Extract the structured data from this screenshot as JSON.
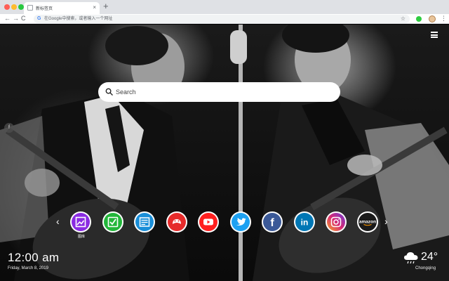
{
  "browser": {
    "tab_title": "新标签页",
    "tab_close": "×",
    "new_tab": "+",
    "omnibox_placeholder": "在Google中搜索，或者输入一个网址",
    "nav": {
      "back": "←",
      "forward": "→",
      "reload": "C"
    }
  },
  "page": {
    "search": {
      "placeholder": "Search"
    },
    "side_toggle_icon": "f",
    "shortcuts": [
      {
        "name": "gallery",
        "label": "图库",
        "color": "#8a2be2",
        "icon": "image-icon"
      },
      {
        "name": "tasks",
        "label": "",
        "color": "#22b63a",
        "icon": "check-icon"
      },
      {
        "name": "news",
        "label": "",
        "color": "#1a8fd9",
        "icon": "news-icon"
      },
      {
        "name": "games",
        "label": "",
        "color": "#e62b2b",
        "icon": "gamepad-icon"
      },
      {
        "name": "youtube",
        "label": "",
        "color": "#ff1f1f",
        "icon": "youtube-icon"
      },
      {
        "name": "twitter",
        "label": "",
        "color": "#1da1f2",
        "icon": "twitter-icon"
      },
      {
        "name": "facebook",
        "label": "",
        "color": "#3b5998",
        "icon": "facebook-icon"
      },
      {
        "name": "linkedin",
        "label": "",
        "color": "#0077b5",
        "icon": "linkedin-icon"
      },
      {
        "name": "instagram",
        "label": "",
        "color": "#d62976",
        "icon": "instagram-icon"
      },
      {
        "name": "amazon",
        "label": "",
        "color": "#1a1a1a",
        "icon": "amazon-icon"
      }
    ],
    "shortcut_text": {
      "facebook": "f",
      "linkedin": "in",
      "amazon": "amazon"
    },
    "clock": {
      "time": "12:00 am",
      "date": "Friday, March 8, 2019"
    },
    "weather": {
      "temperature": "24°",
      "city": "Chongqing",
      "icon": "cloud-rain-icon"
    }
  }
}
